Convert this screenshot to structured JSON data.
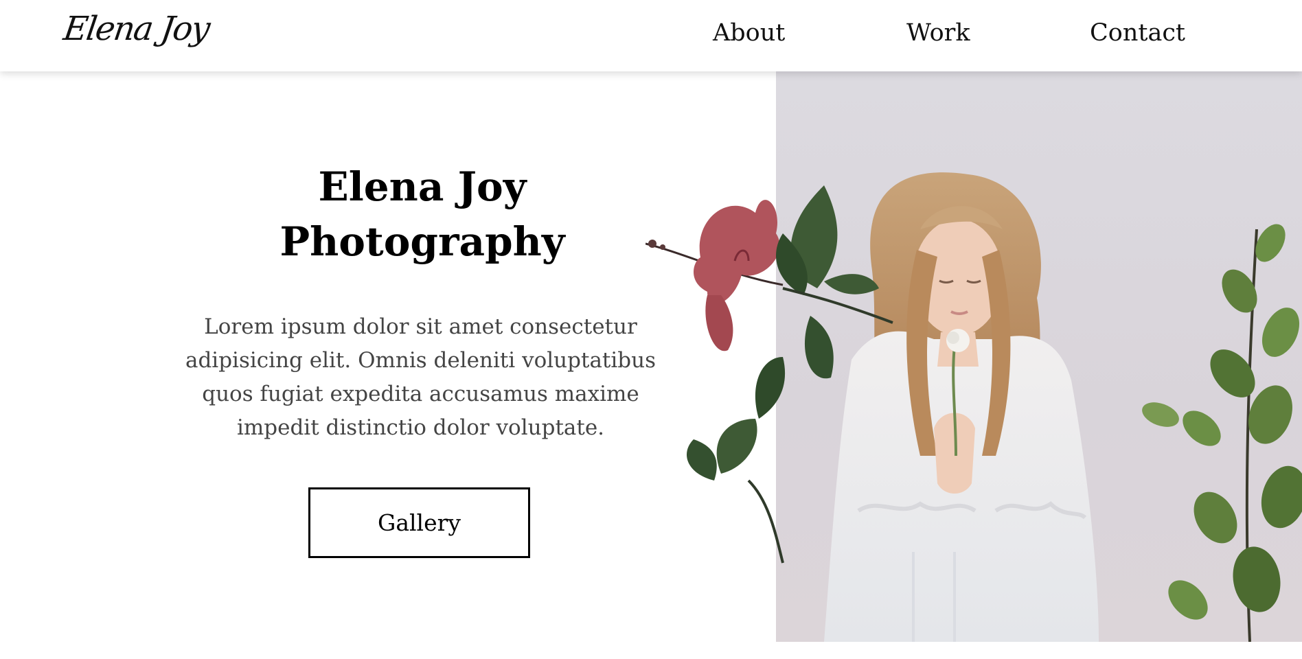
{
  "header": {
    "logo": "Elena Joy",
    "nav": [
      "About",
      "Work",
      "Contact"
    ]
  },
  "hero": {
    "title_line1": "Elena Joy",
    "title_line2": "Photography",
    "description": "Lorem ipsum dolor sit amet consectetur adipisicing elit. Omnis deleniti voluptatibus quos fugiat expedita accusamus maxime impedit distinctio dolor voluptate.",
    "button_label": "Gallery",
    "photo_subject": "woman-holding-white-flower"
  },
  "colors": {
    "background": "#ffffff",
    "photo_backdrop": "#dcdae0",
    "text": "#000000",
    "body_text": "#444444",
    "hibiscus": "#b0545c",
    "leaf": "#3e5a35",
    "eucalyptus": "#5f7f3c"
  }
}
